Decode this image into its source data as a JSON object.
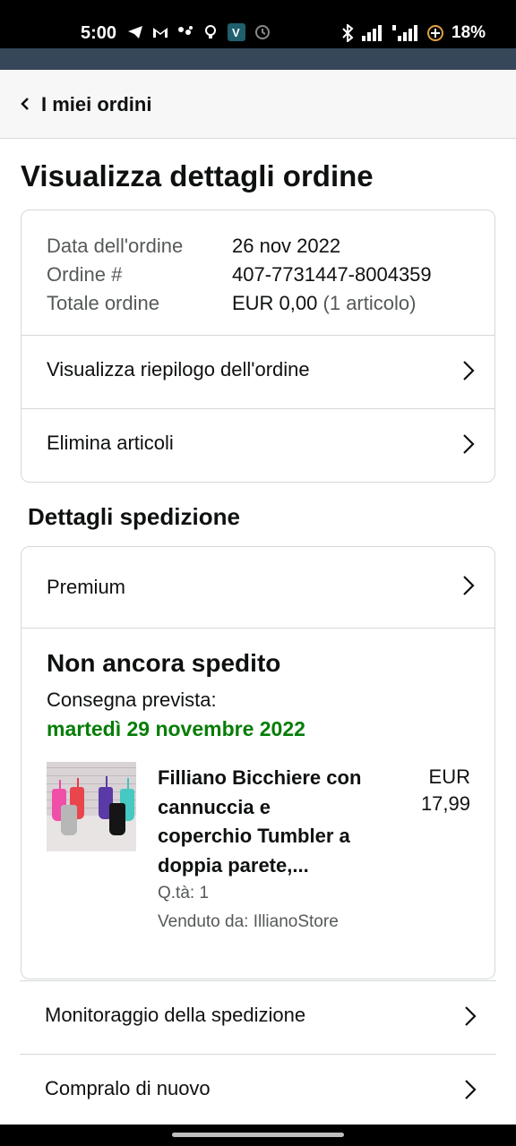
{
  "status_bar": {
    "time": "5:00",
    "battery": "18%"
  },
  "header": {
    "back_label": "I miei ordini"
  },
  "page_title": "Visualizza dettagli ordine",
  "order": {
    "date_label": "Data dell'ordine",
    "date_value": "26 nov 2022",
    "number_label": "Ordine #",
    "number_value": "407-7731447-8004359",
    "total_label": "Totale ordine",
    "total_value": "EUR 0,00",
    "total_items": "(1 articolo)"
  },
  "links": {
    "summary": "Visualizza riepilogo dell'ordine",
    "delete": "Elimina articoli"
  },
  "shipping": {
    "section_title": "Dettagli spedizione",
    "method": "Premium",
    "status": "Non ancora spedito",
    "expected_label": "Consegna prevista:",
    "expected_date": "martedì 29 novembre 2022",
    "delivery_date_color": "#067d07"
  },
  "product": {
    "name": "Filliano Bicchiere con cannuccia e coperchio Tumbler a doppia parete,...",
    "price_currency": "EUR",
    "price_value": "17,99",
    "quantity": "Q.tà: 1",
    "seller": "Venduto da: IllianoStore"
  },
  "bottom_links": {
    "tracking": "Monitoraggio della spedizione",
    "buy_again": "Compralo di nuovo"
  },
  "icons": [
    "telegram-icon",
    "gmail-icon",
    "dots-icon",
    "bulb-icon",
    "app-v-icon",
    "clock-icon",
    "bluetooth-icon",
    "signal-icon",
    "battery-icon",
    "back-chevron-icon",
    "chevron-right-icon"
  ]
}
